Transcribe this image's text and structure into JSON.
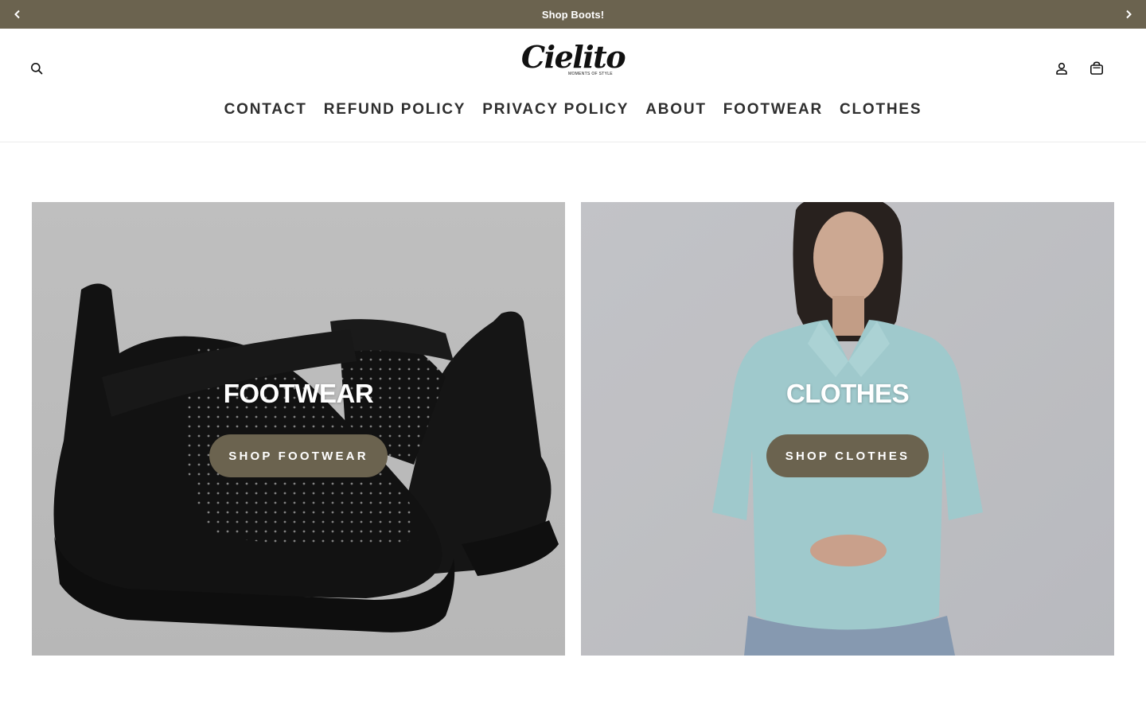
{
  "announcement": {
    "message": "Shop Boots!",
    "prev_icon": "chevron-left-icon",
    "next_icon": "chevron-right-icon"
  },
  "header": {
    "logo_text": "Cielito",
    "logo_tagline": "MOMENTS OF STYLE",
    "icons": [
      "search-icon",
      "account-icon",
      "shopping-bag-icon"
    ],
    "nav": [
      {
        "label": "CONTACT"
      },
      {
        "label": "REFUND POLICY"
      },
      {
        "label": "PRIVACY POLICY"
      },
      {
        "label": "ABOUT"
      },
      {
        "label": "FOOTWEAR"
      },
      {
        "label": "CLOTHES"
      }
    ]
  },
  "collections": [
    {
      "title": "FOOTWEAR",
      "button": "SHOP FOOTWEAR"
    },
    {
      "title": "CLOTHES",
      "button": "SHOP CLOTHES"
    }
  ],
  "colors": {
    "accent": "#6b634f",
    "text": "#2e2e2e",
    "background": "#ffffff"
  }
}
